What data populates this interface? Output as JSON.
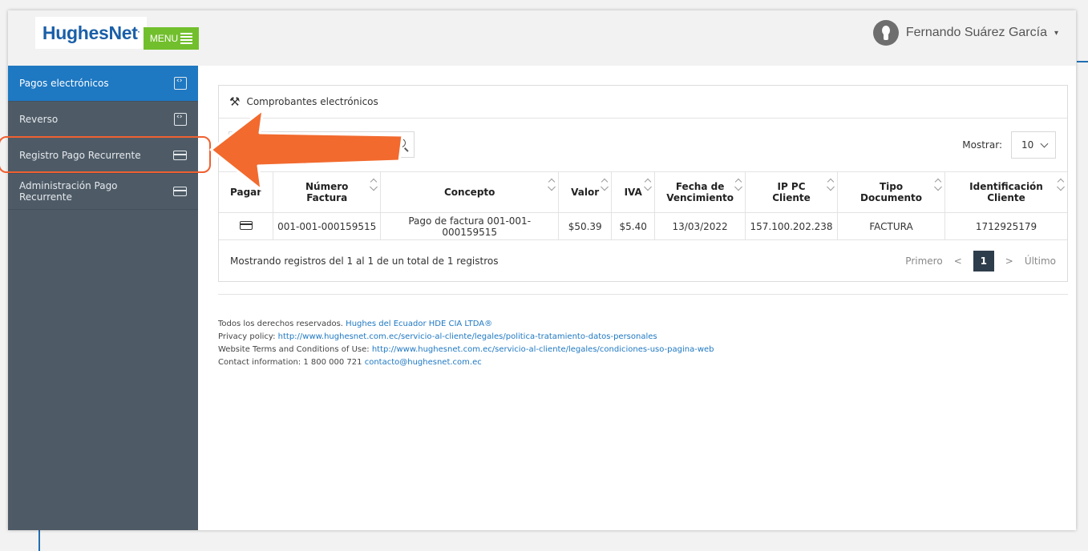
{
  "header": {
    "logo_text": "HughesNet",
    "logo_mark": ".",
    "menu_label": "MENU",
    "user_name": "Fernando Suárez García"
  },
  "sidebar": {
    "items": [
      {
        "label": "Pagos electrónicos",
        "icon": "document-code-icon",
        "active": true
      },
      {
        "label": "Reverso",
        "icon": "document-code-icon",
        "active": false
      },
      {
        "label": "Registro Pago Recurrente",
        "icon": "credit-card-icon",
        "active": false
      },
      {
        "label": "Administración Pago Recurrente",
        "icon": "credit-card-icon",
        "active": false
      }
    ]
  },
  "panel": {
    "title": "Comprobantes electrónicos",
    "search_placeholder": "",
    "show_label": "Mostrar:",
    "show_value": "10",
    "columns": [
      "Pagar",
      "Número Factura",
      "Concepto",
      "Valor",
      "IVA",
      "Fecha de Vencimiento",
      "IP PC Cliente",
      "Tipo Documento",
      "Identificación Cliente"
    ],
    "rows": [
      {
        "numero": "001-001-000159515",
        "concepto": "Pago de factura 001-001-000159515",
        "valor": "$50.39",
        "iva": "$5.40",
        "fecha": "13/03/2022",
        "ip": "157.100.202.238",
        "tipo": "FACTURA",
        "identificacion": "1712925179"
      }
    ],
    "summary": "Mostrando registros del 1 al 1 de un total de 1 registros",
    "pager": {
      "first": "Primero",
      "prev": "<",
      "current": "1",
      "next": ">",
      "last": "Último"
    }
  },
  "footer": {
    "rights_prefix": "Todos los derechos reservados.",
    "rights_link": "Hughes del Ecuador HDE CIA LTDA®",
    "privacy_prefix": "Privacy policy:",
    "privacy_link": "http://www.hughesnet.com.ec/servicio-al-cliente/legales/politica-tratamiento-datos-personales",
    "terms_prefix": "Website Terms and Conditions of Use:",
    "terms_link": "http://www.hughesnet.com.ec/servicio-al-cliente/legales/condiciones-uso-pagina-web",
    "contact_prefix": "Contact information: 1 800 000 721",
    "contact_link": "contacto@hughesnet.com.ec"
  },
  "colors": {
    "sidebar_bg": "#4e5b67",
    "active_item": "#1e78c2",
    "menu_button": "#72bf2d",
    "annotation": "#f26a2e"
  }
}
